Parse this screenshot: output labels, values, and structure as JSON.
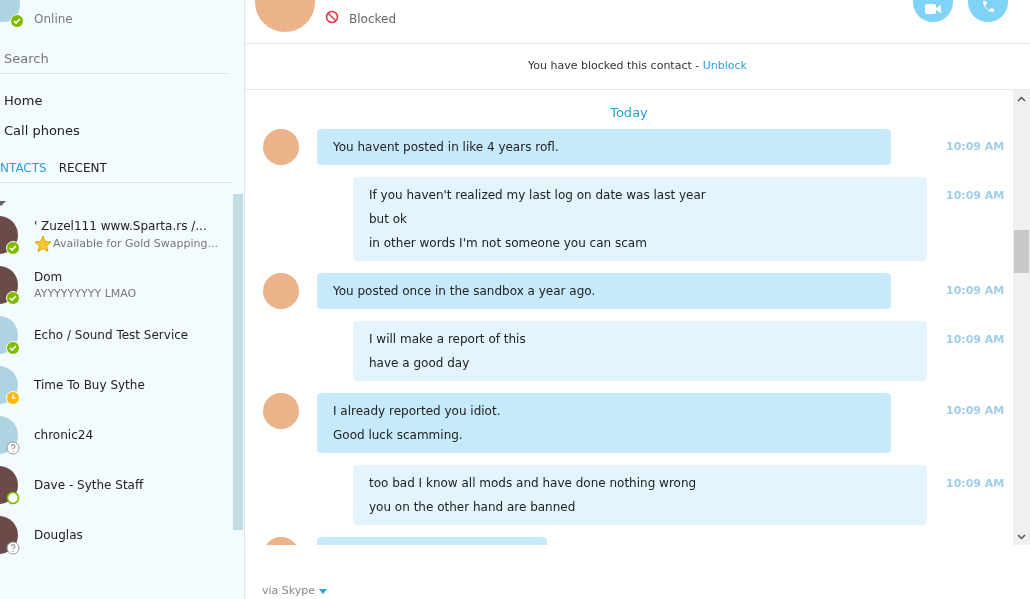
{
  "profile": {
    "status_text": "Online",
    "status": {
      "kind": "online"
    }
  },
  "search": {
    "placeholder": "Search"
  },
  "nav": [
    "Home",
    "Call phones"
  ],
  "tabs": [
    {
      "label": "NTACTS",
      "selected": true
    },
    {
      "label": "RECENT",
      "selected": false
    }
  ],
  "contacts": [
    {
      "name": "' Zuzel111   www.Sparta.rs   /...",
      "mood": "Available for Gold Swapping...",
      "mood_star": true,
      "status": {
        "kind": "online"
      },
      "has_photo": true
    },
    {
      "name": "Dom",
      "mood": "AYYYYYYYYY LMAO",
      "status": {
        "kind": "online"
      },
      "has_photo": true
    },
    {
      "name": "Echo / Sound Test Service",
      "status": {
        "kind": "online"
      },
      "has_photo": false
    },
    {
      "name": "Time To Buy Sythe",
      "status": {
        "kind": "away"
      },
      "has_photo": false
    },
    {
      "name": "chronic24",
      "status": {
        "kind": "unknown"
      },
      "has_photo": false
    },
    {
      "name": "Dave - Sythe Staff",
      "status": {
        "kind": "ring"
      },
      "has_photo": true
    },
    {
      "name": "Douglas",
      "status": {
        "kind": "unknown"
      },
      "has_photo": true
    }
  ],
  "conversation": {
    "status_text": "Blocked",
    "banner": "You have blocked this contact - ",
    "unblock_link": "Unblock",
    "day": "Today",
    "footer": "via Skype"
  },
  "messages": [
    {
      "kind": "incoming",
      "lines": [
        "You havent posted in like 4 years rofl."
      ],
      "time": "10:09 AM"
    },
    {
      "kind": "outgoing",
      "lines": [
        "If you haven't realized my last log on date was last year",
        "but ok",
        "in other words I'm not someone you can scam"
      ],
      "time": "10:09 AM"
    },
    {
      "kind": "incoming",
      "lines": [
        "You posted once in the sandbox a year ago."
      ],
      "time": "10:09 AM"
    },
    {
      "kind": "outgoing",
      "lines": [
        "I will make a report of this",
        "have a good day"
      ],
      "time": "10:09 AM"
    },
    {
      "kind": "incoming",
      "lines": [
        "I already reported you idiot.",
        "Good luck scamming."
      ],
      "time": "10:09 AM"
    },
    {
      "kind": "outgoing",
      "lines": [
        "too bad I know all mods and have done nothing wrong",
        "you on the other hand are banned"
      ],
      "time": "10:09 AM"
    }
  ]
}
